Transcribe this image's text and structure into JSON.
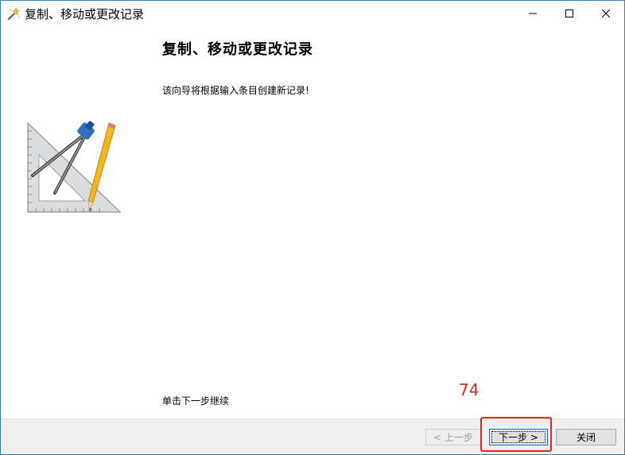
{
  "window": {
    "title": "复制、移动或更改记录",
    "title_icon": "wand-icon"
  },
  "content": {
    "heading": "复制、移动或更改记录",
    "intro": "该向导将根据输入条目创建新记录!",
    "continue_hint": "单击下一步继续",
    "illustration": "drafting-tools-icon"
  },
  "annotation": {
    "number": "74",
    "color": "#e0281e"
  },
  "buttons": {
    "back_label": "< 上一步",
    "next_label": "下一步 >",
    "close_label": "关闭"
  },
  "colors": {
    "window_border": "#3c7fb1",
    "footer_bg": "#f0f0f0",
    "focus_border": "#0078d7"
  }
}
